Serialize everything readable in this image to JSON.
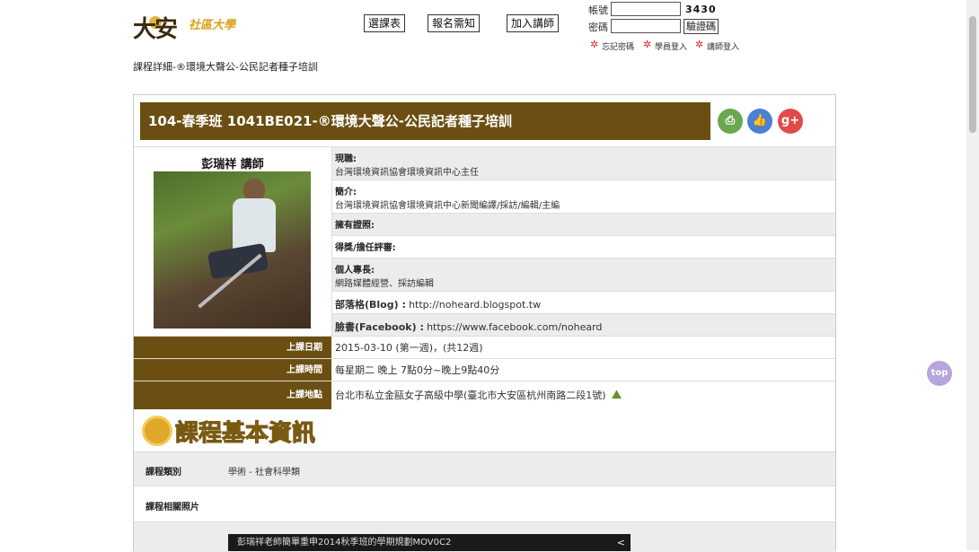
{
  "header": {
    "logo_text": "大安",
    "logo_sub": "社區大學",
    "nav": [
      "選課表",
      "報名需知",
      "加入講師"
    ],
    "login": {
      "account_label": "帳號",
      "password_label": "密碼",
      "captcha": "3430",
      "verify_button": "驗證碼",
      "links": [
        "忘記密碼",
        "學員登入",
        "講師登入"
      ]
    }
  },
  "breadcrumb": "課程詳細-®環境大聲公-公民記者種子培訓",
  "course": {
    "title": "104-春季班 1041BE021-®環境大聲公-公民記者種子培訓",
    "social": [
      "print",
      "like",
      "g+"
    ]
  },
  "instructor": {
    "name": "彭瑞祥 講師",
    "fields": [
      {
        "label": "現職:",
        "value": "台灣環境資訊協會環境資訊中心主任"
      },
      {
        "label": "簡介:",
        "value": "台灣環境資訊協會環境資訊中心新聞編譯/採訪/編輯/主編"
      },
      {
        "label": "擁有證照:",
        "value": ""
      },
      {
        "label": "得獎/擔任評審:",
        "value": ""
      },
      {
        "label": "個人專長:",
        "value": "網路媒體經營、採訪編輯"
      },
      {
        "label": "部落格(Blog) :",
        "value": "http://noheard.blogspot.tw"
      },
      {
        "label": "臉書(Facebook) :",
        "value": "https://www.facebook.com/noheard"
      }
    ]
  },
  "schedule": [
    {
      "label": "上課日期",
      "value": "2015-03-10 (第一週)，(共12週)"
    },
    {
      "label": "上課時間",
      "value": "每星期二 晚上 7點0分~晚上9點40分"
    },
    {
      "label": "上課地點",
      "value": "台北市私立金甌女子高級中學(臺北市大安區杭州南路二段1號)"
    }
  ],
  "basic_info": {
    "title": "課程基本資訊",
    "category_label": "課程類別",
    "category_value": "學術 - 社會科學類",
    "photos_label": "課程相關照片"
  },
  "video": {
    "title": "彭瑞祥老師簡單重申2014秋季班的學期規劃MOV0C2"
  },
  "totop_label": "top ↑"
}
